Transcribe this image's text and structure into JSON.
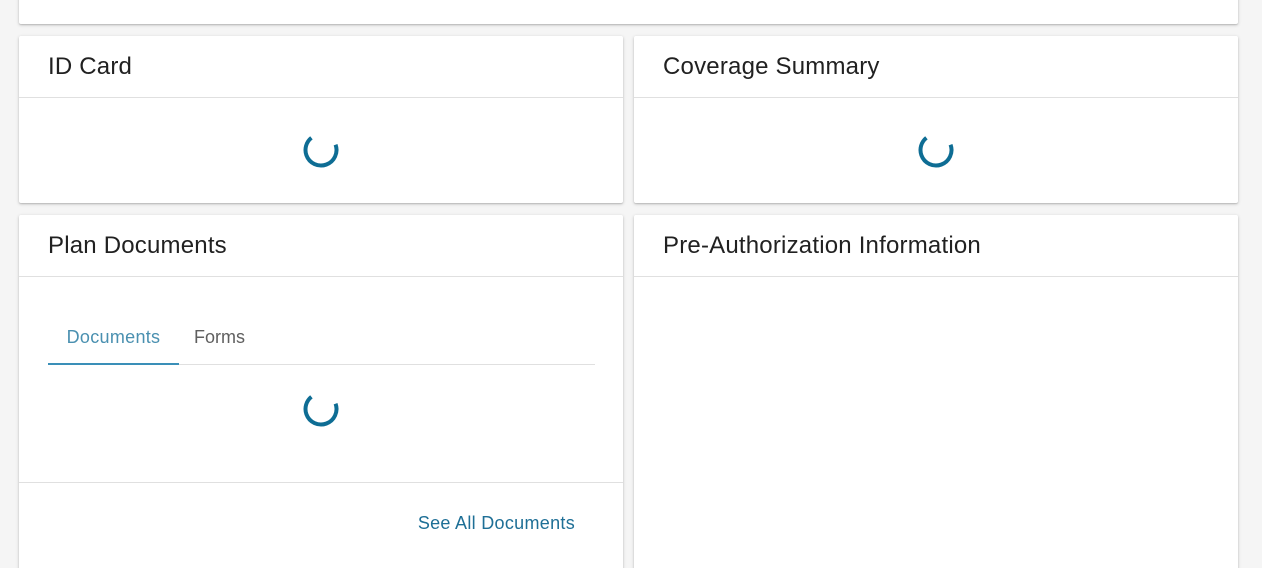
{
  "colors": {
    "accent": "#0e6d94",
    "tab_active": "#4a90b0",
    "link": "#1e6f96",
    "background": "#f5f5f5",
    "card": "#ffffff"
  },
  "id_card": {
    "title": "ID Card",
    "spinner_icon": "loading-spinner-icon"
  },
  "coverage_summary": {
    "title": "Coverage Summary",
    "spinner_icon": "loading-spinner-icon"
  },
  "plan_documents": {
    "title": "Plan Documents",
    "tabs": [
      {
        "label": "Documents",
        "active": true
      },
      {
        "label": "Forms",
        "active": false
      }
    ],
    "spinner_icon": "loading-spinner-icon",
    "see_all_label": "See All Documents"
  },
  "pre_authorization": {
    "title": "Pre-Authorization Information"
  }
}
